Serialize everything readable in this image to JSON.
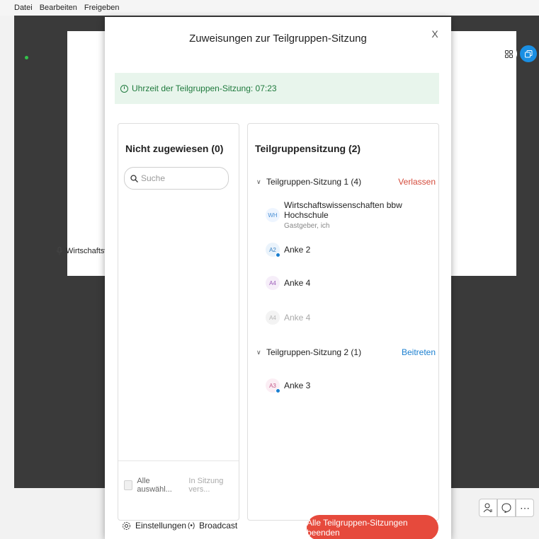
{
  "menu": [
    "Datei",
    "Bearbeiten",
    "Freigeben"
  ],
  "stage": {
    "name_tag": "Wirtschaftswisse"
  },
  "dialog": {
    "title": "Zuweisungen zur Teilgruppen-Sitzung",
    "close_label": "X",
    "timer_text": "Uhrzeit der Teilgruppen-Sitzung: 07:23",
    "unassigned": {
      "heading": "Nicht zugewiesen (0)",
      "search_placeholder": "Suche",
      "select_all_label": "Alle auswähl...",
      "in_session_label": "In Sitzung vers..."
    },
    "breakouts": {
      "heading": "Teilgruppensitzung  (2)",
      "groups": [
        {
          "name": "Teilgruppen-Sitzung 1 (4)",
          "action": "Verlassen",
          "members": [
            {
              "initials": "WH",
              "name": "Wirtschaftswissenschaften bbw Hochschule",
              "sub": "Gastgeber, ich"
            },
            {
              "initials": "A2",
              "name": "Anke 2"
            },
            {
              "initials": "A4",
              "name": "Anke 4"
            },
            {
              "initials": "A4",
              "name": "Anke 4"
            }
          ]
        },
        {
          "name": "Teilgruppen-Sitzung 2 (1)",
          "action": "Beitreten",
          "members": [
            {
              "initials": "A3",
              "name": "Anke 3"
            }
          ]
        }
      ]
    },
    "footer": {
      "settings_label": "Einstellungen",
      "broadcast_label": "Broadcast",
      "end_all_label": "Alle Teilgruppen-Sitzungen beenden"
    }
  },
  "icons": {
    "settings": "gear-icon",
    "broadcast": "broadcast-icon",
    "clock": "clock-icon",
    "search": "search-icon"
  },
  "colors": {
    "accent_red": "#e64a3c",
    "join_blue": "#1a7fd0",
    "timer_green": "#1f7a3d"
  }
}
